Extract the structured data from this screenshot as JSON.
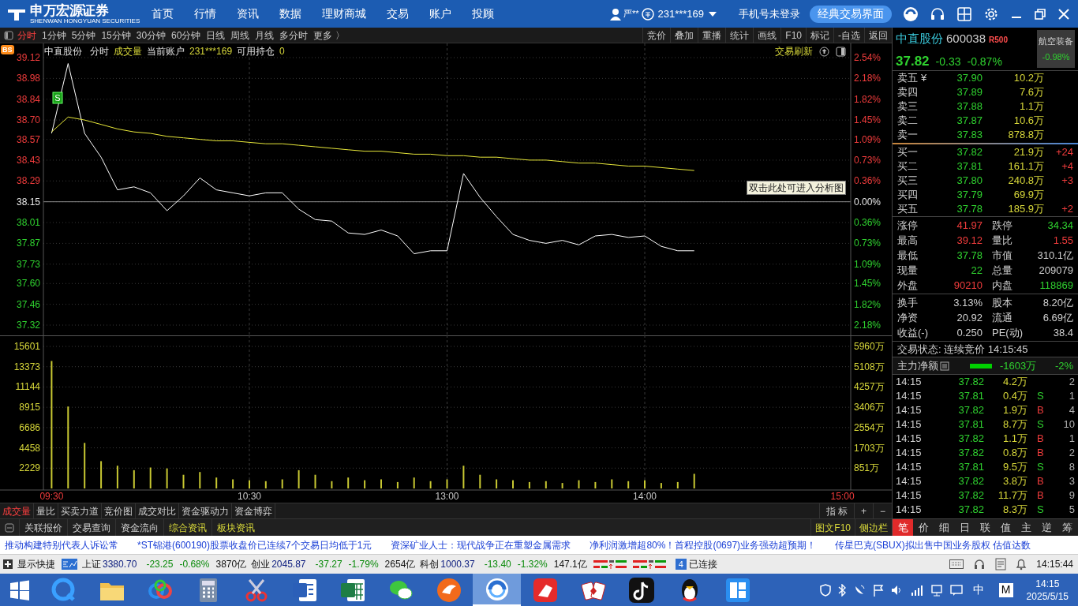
{
  "header": {
    "logo_text": "申万宏源证券",
    "logo_subtext": "SHENWAN HONGYUAN SECURITIES",
    "nav": [
      "首页",
      "行情",
      "资讯",
      "数据",
      "理财商城",
      "交易",
      "账户",
      "投顾"
    ],
    "user": "严**",
    "account": "231***169",
    "phone_status": "手机号未登录",
    "classic_button": "经典交易界面"
  },
  "toolbar": {
    "periods": [
      {
        "label": "分时",
        "selected": true
      },
      {
        "label": "1分钟",
        "selected": false
      },
      {
        "label": "5分钟",
        "selected": false
      },
      {
        "label": "15分钟",
        "selected": false
      },
      {
        "label": "30分钟",
        "selected": false
      },
      {
        "label": "60分钟",
        "selected": false
      },
      {
        "label": "日线",
        "selected": false
      },
      {
        "label": "周线",
        "selected": false
      },
      {
        "label": "月线",
        "selected": false
      },
      {
        "label": "多分时",
        "selected": false
      },
      {
        "label": "更多 〉",
        "selected": false
      }
    ],
    "tools": [
      "竞价",
      "叠加",
      "重播",
      "统计",
      "画线",
      "F10",
      "标记",
      "-自选",
      "返回"
    ]
  },
  "chart_header": {
    "badge": "BS",
    "stock": "中直股份",
    "mode": "分时",
    "indicator": "成交量",
    "account_label": "当前账户",
    "account": "231***169",
    "holding_label": "可用持仓",
    "holding": "0",
    "refresh": "交易刷新"
  },
  "tooltip": "双击此处可进入分析图",
  "price_chart": {
    "marker": "S",
    "pct_labels": [
      {
        "label": "2.54%",
        "color": "#f03c3c"
      },
      {
        "label": "2.18%",
        "color": "#f03c3c"
      },
      {
        "label": "1.82%",
        "color": "#f03c3c"
      },
      {
        "label": "1.45%",
        "color": "#f03c3c"
      },
      {
        "label": "1.09%",
        "color": "#f03c3c"
      },
      {
        "label": "0.73%",
        "color": "#f03c3c"
      },
      {
        "label": "0.36%",
        "color": "#f03c3c"
      },
      {
        "label": "0.00%",
        "color": "#e8e8e8"
      },
      {
        "label": "0.36%",
        "color": "#2fd12f"
      },
      {
        "label": "0.73%",
        "color": "#2fd12f"
      },
      {
        "label": "1.09%",
        "color": "#2fd12f"
      },
      {
        "label": "1.45%",
        "color": "#2fd12f"
      },
      {
        "label": "1.82%",
        "color": "#2fd12f"
      },
      {
        "label": "2.18%",
        "color": "#2fd12f"
      }
    ],
    "chart_data": {
      "type": "line",
      "series": [
        {
          "color": "#ffffff",
          "values": [
            38.61,
            39.08,
            38.61,
            38.45,
            38.23,
            38.25,
            38.21,
            38.09,
            38.19,
            38.31,
            38.23,
            38.21,
            38.19,
            38.21,
            38.21,
            38.1,
            38.03,
            38.02,
            37.94,
            37.93,
            37.96,
            37.92,
            37.8,
            37.82,
            37.82,
            38.34,
            38.18,
            38.05,
            37.93,
            37.89,
            37.87,
            37.89,
            37.86,
            37.92,
            37.93,
            37.91,
            37.92,
            37.85,
            37.82,
            37.82,
            null,
            null,
            null,
            null,
            null,
            null,
            null,
            null,
            null
          ]
        },
        {
          "color": "#e8e83a",
          "values": [
            38.62,
            38.72,
            38.7,
            38.67,
            38.64,
            38.62,
            38.61,
            38.59,
            38.58,
            38.57,
            38.56,
            38.56,
            38.55,
            38.54,
            38.54,
            38.53,
            38.52,
            38.51,
            38.5,
            38.49,
            38.49,
            38.48,
            38.47,
            38.47,
            38.46,
            38.46,
            38.45,
            38.45,
            38.44,
            38.43,
            38.43,
            38.42,
            38.41,
            38.41,
            38.4,
            38.39,
            38.39,
            38.38,
            38.37,
            38.36,
            null,
            null,
            null,
            null,
            null,
            null,
            null,
            null,
            null
          ]
        }
      ],
      "ylim": [
        37.32,
        39.12
      ],
      "grid": true,
      "ref_lines": [
        {
          "axis": "y",
          "value": 38.15
        }
      ],
      "yticks": [
        {
          "value": 39.12,
          "label": "39.12"
        },
        {
          "value": 38.98,
          "label": "38.98"
        },
        {
          "value": 38.84,
          "label": "38.84"
        },
        {
          "value": 38.7,
          "label": "38.70"
        },
        {
          "value": 38.57,
          "label": "38.57"
        },
        {
          "value": 38.43,
          "label": "38.43"
        },
        {
          "value": 38.29,
          "label": "38.29"
        },
        {
          "value": 38.15,
          "label": "38.15"
        },
        {
          "value": 38.01,
          "label": "38.01"
        },
        {
          "value": 37.87,
          "label": "37.87"
        },
        {
          "value": 37.73,
          "label": "37.73"
        },
        {
          "value": 37.6,
          "label": "37.60"
        },
        {
          "value": 37.46,
          "label": "37.46"
        },
        {
          "value": 37.32,
          "label": "37.32"
        }
      ]
    }
  },
  "volume_chart": {
    "right_labels": [
      "5960万",
      "5108万",
      "4257万",
      "3406万",
      "2554万",
      "1703万",
      "851万"
    ],
    "chart_data": {
      "type": "bar",
      "categories": [
        "09:30",
        null,
        null,
        null,
        null,
        null,
        null,
        null,
        null,
        null,
        null,
        null,
        "10:30",
        null,
        null,
        null,
        null,
        null,
        null,
        null,
        null,
        null,
        null,
        null,
        "13:00",
        null,
        null,
        null,
        null,
        null,
        null,
        null,
        null,
        null,
        null,
        null,
        "14:00",
        null,
        null,
        null,
        null,
        null,
        null,
        null,
        null,
        null,
        null,
        null,
        "15:00"
      ],
      "series": [
        {
          "color": "#c8c832",
          "values": [
            14000,
            9000,
            5000,
            3000,
            2500,
            2000,
            2300,
            2200,
            1500,
            1800,
            1200,
            1000,
            900,
            800,
            1000,
            2000,
            1500,
            800,
            1200,
            900,
            1000,
            700,
            1200,
            800,
            1000,
            2500,
            1500,
            1000,
            900,
            700,
            800,
            600,
            900,
            700,
            1000,
            800,
            900,
            600,
            700,
            1600,
            null,
            null,
            null,
            null,
            null,
            null,
            null,
            null,
            null
          ]
        }
      ],
      "ylim": [
        0,
        15601
      ],
      "grid": true,
      "yticks": [
        {
          "value": 15601,
          "label": "15601"
        },
        {
          "value": 13373,
          "label": "13373"
        },
        {
          "value": 11144,
          "label": "11144"
        },
        {
          "value": 8915,
          "label": "8915"
        },
        {
          "value": 6686,
          "label": "6686"
        },
        {
          "value": 4458,
          "label": "4458"
        },
        {
          "value": 2229,
          "label": "2229"
        }
      ]
    }
  },
  "indicator_tabs": [
    {
      "label": "成交量",
      "selected": true
    },
    {
      "label": "量比",
      "selected": false
    },
    {
      "label": "买卖力道",
      "selected": false
    },
    {
      "label": "竞价图",
      "selected": false
    },
    {
      "label": "成交对比",
      "selected": false
    },
    {
      "label": "资金驱动力",
      "selected": false
    },
    {
      "label": "资金博弈",
      "selected": false
    }
  ],
  "indicator_tools": [
    "指 标",
    "+",
    "−"
  ],
  "info_tabs": [
    {
      "label": "关联报价",
      "highlighted": false
    },
    {
      "label": "交易查询",
      "highlighted": false
    },
    {
      "label": "资金流向",
      "highlighted": false
    },
    {
      "label": "综合资讯",
      "highlighted": true
    },
    {
      "label": "板块资讯",
      "highlighted": true
    }
  ],
  "info_right": [
    "图文F10",
    "侧边栏"
  ],
  "quote": {
    "name": "中直股份",
    "code": "600038",
    "tag": "R500",
    "price": "37.82",
    "change": "-0.33",
    "change_pct": "-0.87%",
    "sector": "航空装备",
    "sector_pct": "-0.98%",
    "ask_flag": "¥",
    "asks": [
      {
        "label": "卖五",
        "price": "37.90",
        "volume": "10.2万"
      },
      {
        "label": "卖四",
        "price": "37.89",
        "volume": "7.6万"
      },
      {
        "label": "卖三",
        "price": "37.88",
        "volume": "1.1万"
      },
      {
        "label": "卖二",
        "price": "37.87",
        "volume": "10.6万"
      },
      {
        "label": "卖一",
        "price": "37.83",
        "volume": "878.8万"
      }
    ],
    "bids": [
      {
        "label": "买一",
        "price": "37.82",
        "volume": "21.9万",
        "count": "+24"
      },
      {
        "label": "买二",
        "price": "37.81",
        "volume": "161.1万",
        "count": "+4"
      },
      {
        "label": "买三",
        "price": "37.80",
        "volume": "240.8万",
        "count": "+3"
      },
      {
        "label": "买四",
        "price": "37.79",
        "volume": "69.9万"
      },
      {
        "label": "买五",
        "price": "37.78",
        "volume": "185.9万",
        "count": "+2"
      }
    ],
    "stats": [
      {
        "label": "涨停",
        "value": "41.97",
        "color": "#f03c3c"
      },
      {
        "label": "跌停",
        "value": "34.34",
        "color": "#2fd12f"
      },
      {
        "label": "最高",
        "value": "39.12",
        "color": "#f03c3c"
      },
      {
        "label": "量比",
        "value": "1.55",
        "color": "#f03c3c"
      },
      {
        "label": "最低",
        "value": "37.78",
        "color": "#2fd12f"
      },
      {
        "label": "市值",
        "value": "310.1亿",
        "color": "#d0d0d0"
      },
      {
        "label": "现量",
        "value": "22",
        "color": "#2fd12f"
      },
      {
        "label": "总量",
        "value": "209079",
        "color": "#d0d0d0"
      },
      {
        "label": "外盘",
        "value": "90210",
        "color": "#f03c3c"
      },
      {
        "label": "内盘",
        "value": "118869",
        "color": "#2fd12f"
      }
    ],
    "stats2": [
      {
        "label": "换手",
        "value": "3.13%"
      },
      {
        "label": "股本",
        "value": "8.20亿"
      },
      {
        "label": "净资",
        "value": "20.92"
      },
      {
        "label": "流通",
        "value": "6.69亿"
      },
      {
        "label": "收益(-)",
        "value": "0.250"
      },
      {
        "label": "PE(动)",
        "value": "38.4"
      }
    ],
    "trade_status": "交易状态: 连续竞价 14:15:45",
    "main_flow": {
      "label": "主力净额",
      "value": "-1603万",
      "pct": "-2%"
    },
    "ticks": [
      {
        "time": "14:15",
        "price": "37.82",
        "volume": "4.2万",
        "count": "2"
      },
      {
        "time": "14:15",
        "price": "37.81",
        "volume": "0.4万",
        "kind": "sell",
        "side": "S",
        "count": "1"
      },
      {
        "time": "14:15",
        "price": "37.82",
        "volume": "1.9万",
        "kind": "buy",
        "side": "B",
        "count": "4"
      },
      {
        "time": "14:15",
        "price": "37.81",
        "volume": "8.7万",
        "kind": "sell",
        "side": "S",
        "count": "10"
      },
      {
        "time": "14:15",
        "price": "37.82",
        "volume": "1.1万",
        "kind": "buy",
        "side": "B",
        "count": "1"
      },
      {
        "time": "14:15",
        "price": "37.82",
        "volume": "0.8万",
        "kind": "buy",
        "side": "B",
        "count": "2"
      },
      {
        "time": "14:15",
        "price": "37.81",
        "volume": "9.5万",
        "kind": "sell",
        "side": "S",
        "count": "8"
      },
      {
        "time": "14:15",
        "price": "37.82",
        "volume": "3.8万",
        "kind": "buy",
        "side": "B",
        "count": "3"
      },
      {
        "time": "14:15",
        "price": "37.82",
        "volume": "11.7万",
        "kind": "buy",
        "side": "B",
        "count": "9"
      },
      {
        "time": "14:15",
        "price": "37.82",
        "volume": "8.3万",
        "kind": "sell",
        "side": "S",
        "count": "5"
      }
    ],
    "detail_tabs": [
      {
        "label": "笔",
        "selected": true
      },
      {
        "label": "价",
        "selected": false
      },
      {
        "label": "细",
        "selected": false
      },
      {
        "label": "日",
        "selected": false
      },
      {
        "label": "联",
        "selected": false
      },
      {
        "label": "值",
        "selected": false
      },
      {
        "label": "主",
        "selected": false
      },
      {
        "label": "逆",
        "selected": false
      },
      {
        "label": "筹",
        "selected": false
      }
    ]
  },
  "news": [
    "推动构建特别代表人诉讼常",
    "*ST锦港(600190)股票收盘价已连续7个交易日均低于1元",
    "资深矿业人士：现代战争正在重塑金属需求",
    "净利润激增超80%！首程控股(0697)业务强劲超预期！",
    "传星巴克(SBUX)拟出售中国业务股权 估值达数"
  ],
  "status_bar": {
    "shortcut": "显示快捷",
    "indices": [
      {
        "name": "上证",
        "value": "3380.70",
        "change": "-23.25",
        "pct": "-0.68%",
        "amount": "3870亿"
      },
      {
        "name": "创业",
        "value": "2045.87",
        "change": "-37.27",
        "pct": "-1.79%",
        "amount": "2654亿"
      },
      {
        "name": "科创",
        "value": "1000.37",
        "change": "-13.40",
        "pct": "-1.32%",
        "amount": "147.1亿"
      }
    ],
    "connection_count": "4",
    "connection": "已连接",
    "time": "14:15:44"
  },
  "taskbar": {
    "apps": [
      {
        "kind": "search",
        "selected": false
      },
      {
        "kind": "folder",
        "selected": false
      },
      {
        "kind": "cloud",
        "selected": false
      },
      {
        "kind": "calculator",
        "selected": false
      },
      {
        "kind": "scissors",
        "selected": false
      },
      {
        "kind": "document",
        "selected": false
      },
      {
        "kind": "spreadsheet",
        "selected": false
      },
      {
        "kind": "chat",
        "selected": false
      },
      {
        "kind": "orange",
        "selected": false
      },
      {
        "kind": "trading",
        "selected": true
      },
      {
        "kind": "red",
        "selected": false
      },
      {
        "kind": "cards",
        "selected": false
      },
      {
        "kind": "music",
        "selected": false
      },
      {
        "kind": "penguin",
        "selected": false
      },
      {
        "kind": "blue",
        "selected": false
      }
    ],
    "ime": "中",
    "ime_mode": "M",
    "time": "14:15",
    "date": "2025/5/15"
  }
}
